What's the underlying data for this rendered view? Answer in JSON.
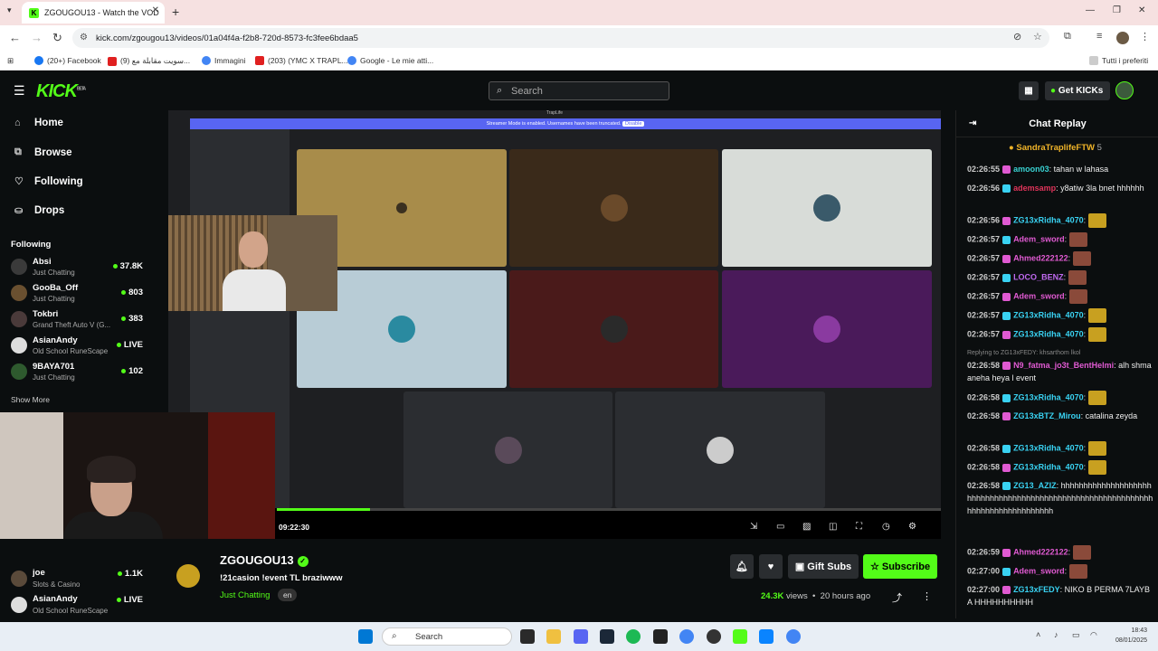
{
  "browser": {
    "tab_title": "ZGOUGOU13 - Watch the VOD",
    "url": "kick.com/zgougou13/videos/01a04f4a-f2b8-720d-8573-fc3fee6bdaa5",
    "bookmarks": [
      "(20+) Facebook",
      "(9) سويت مقابلة مع...",
      "Immagini",
      "(203) (YMC X TRAPL...",
      "Google - Le mie atti..."
    ],
    "bookmarks_right": "Tutti i preferiti"
  },
  "header": {
    "logo": "KICK",
    "logo_tag": "BETA",
    "search_placeholder": "Search",
    "get_kicks": "Get KICKs"
  },
  "sidebar": {
    "nav": [
      {
        "label": "Home",
        "icon": "home-icon"
      },
      {
        "label": "Browse",
        "icon": "browse-icon"
      },
      {
        "label": "Following",
        "icon": "heart-icon"
      },
      {
        "label": "Drops",
        "icon": "drops-icon"
      }
    ],
    "following_title": "Following",
    "following": [
      {
        "name": "Absi",
        "category": "Just Chatting",
        "count": "37.8K"
      },
      {
        "name": "GooBa_Off",
        "category": "Just Chatting",
        "count": "803"
      },
      {
        "name": "Tokbri",
        "category": "Grand Theft Auto V (G...",
        "count": "383"
      },
      {
        "name": "AsianAndy",
        "category": "Old School RuneScape",
        "count": "LIVE"
      },
      {
        "name": "9BAYA701",
        "category": "Just Chatting",
        "count": "102"
      }
    ],
    "show_more": "Show More",
    "following_lower": [
      {
        "name": "joe",
        "category": "Slots & Casino",
        "count": "1.1K"
      },
      {
        "name": "AsianAndy",
        "category": "Old School RuneScape",
        "count": "LIVE"
      }
    ]
  },
  "player": {
    "discord_title": "TrapLife",
    "discord_banner": "Streamer Mode is enabled. Usernames have been truncated.",
    "discord_banner_btn": "Disable",
    "time": "09:22:30",
    "progress": 0.14
  },
  "channel": {
    "name": "ZGOUGOU13",
    "title": "!21casion !event TL braziwww",
    "category": "Just Chatting",
    "language": "en",
    "gift_subs": "Gift Subs",
    "subscribe": "Subscribe",
    "views": "24.3K",
    "views_label": "views",
    "ago": "20 hours ago"
  },
  "chat": {
    "title": "Chat Replay",
    "pinned_user": "SandraTraplifeFTW",
    "pinned_count": "5",
    "messages": [
      {
        "time": "02:26:55",
        "user": "amoon03",
        "color": "#39d2d2",
        "text": "tahan w lahasa"
      },
      {
        "time": "02:26:56",
        "user": "ademsamp",
        "color": "#e0345a",
        "text": "y8atiw 3la bnet hhhhhh"
      },
      {
        "time": "02:26:56",
        "user": "ZG13xRidha_4070",
        "color": "#39d2f2",
        "text": ""
      },
      {
        "time": "02:26:57",
        "user": "Adem_sword",
        "color": "#e05ad2",
        "text": ""
      },
      {
        "time": "02:26:57",
        "user": "Ahmed222122",
        "color": "#e05ad2",
        "text": ""
      },
      {
        "time": "02:26:57",
        "user": "LOCO_BENZ",
        "color": "#c06af0",
        "text": ""
      },
      {
        "time": "02:26:57",
        "user": "Adem_sword",
        "color": "#e05ad2",
        "text": ""
      },
      {
        "time": "02:26:57",
        "user": "ZG13xRidha_4070",
        "color": "#39d2f2",
        "text": ""
      },
      {
        "time": "02:26:57",
        "user": "ZG13xRidha_4070",
        "color": "#39d2f2",
        "text": ""
      },
      {
        "reply": "Replying to ZG13xFEDY: khsarthom lkol"
      },
      {
        "time": "02:26:58",
        "user": "N9_fatma_jo3t_BentHelmi",
        "color": "#e05ad2",
        "text": "alh shmaaneha heya l event"
      },
      {
        "time": "02:26:58",
        "user": "ZG13xRidha_4070",
        "color": "#39d2f2",
        "text": ""
      },
      {
        "time": "02:26:58",
        "user": "ZG13xBTZ_Mirou",
        "color": "#39d2f2",
        "text": "catalina zeyda"
      },
      {
        "time": "02:26:58",
        "user": "ZG13xRidha_4070",
        "color": "#39d2f2",
        "text": ""
      },
      {
        "time": "02:26:58",
        "user": "ZG13xRidha_4070",
        "color": "#39d2f2",
        "text": ""
      },
      {
        "time": "02:26:58",
        "user": "ZG13_AZIZ",
        "color": "#39d2f2",
        "text": "hhhhhhhhhhhhhhhhhhhhhhhhhhhhhhhhhhhhhhhhhhhhhhhhhhhhhhhhhhhhhhhhhhhhhhhhhhhhhhhh"
      },
      {
        "time": "02:26:59",
        "user": "Ahmed222122",
        "color": "#e05ad2",
        "text": ""
      },
      {
        "time": "02:27:00",
        "user": "Adem_sword",
        "color": "#e05ad2",
        "text": ""
      },
      {
        "time": "02:27:00",
        "user": "ZG13xFEDY",
        "color": "#39d2f2",
        "text": "NIKO B PERMA 7LAYBA HHHHHHHHHH"
      }
    ]
  },
  "taskbar": {
    "search": "Search",
    "clock_time": "18:43",
    "clock_date": "08/01/2025"
  },
  "colors": {
    "brand": "#53fc18",
    "background": "#0b0e0f"
  }
}
